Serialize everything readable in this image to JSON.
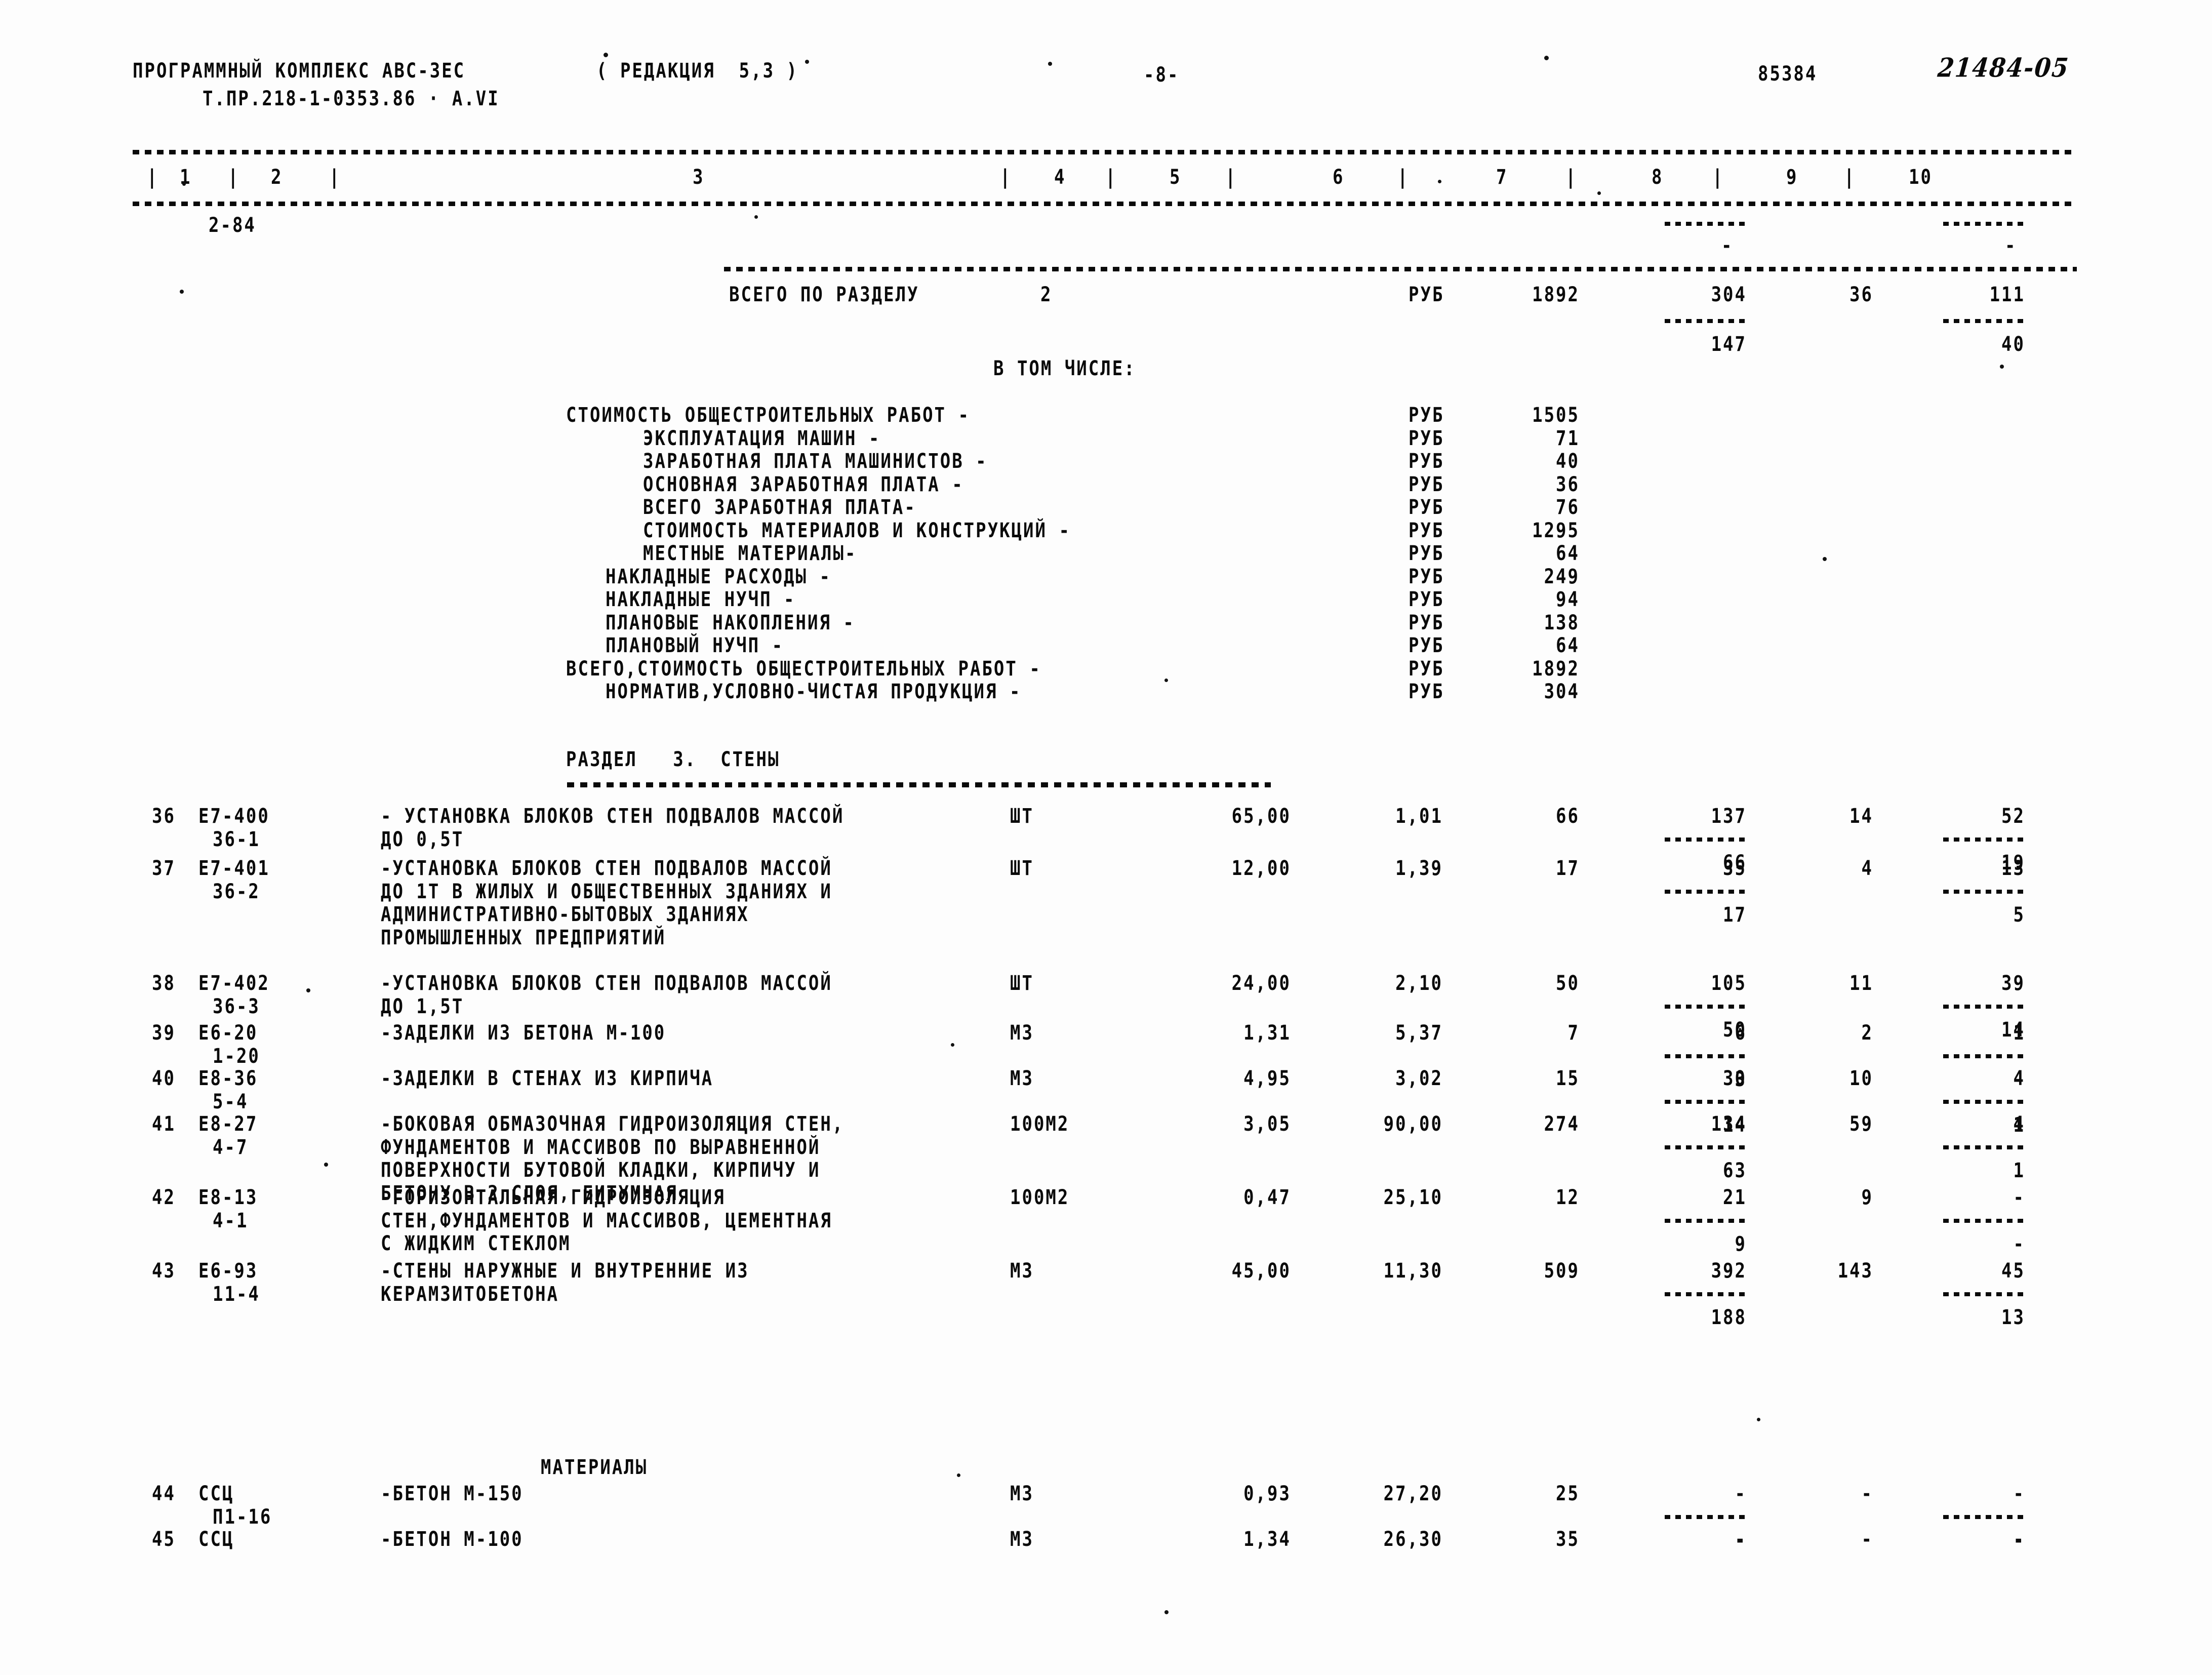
{
  "header": {
    "program_title": "ПРОГРАММНЫЙ КОМПЛЕКС АВС-3ЕС",
    "edition": "( РЕДАКЦИЯ  5,3 )",
    "project_code": "Т.ПР.218-1-0353.86 · А.VI",
    "page_marker": "-8-",
    "doc_number": "85384",
    "hand_number": "21484-05"
  },
  "columns": [
    "1",
    "2",
    "3",
    "4",
    "5",
    "6",
    "7",
    "8",
    "9",
    "10"
  ],
  "marker_row": {
    "code": "2-84"
  },
  "section_total": {
    "label": "ВСЕГО ПО РАЗДЕЛУ",
    "number": "2",
    "unit": "РУБ",
    "c7": "1892",
    "c8": "304",
    "c9": "36",
    "c10": "111",
    "sub_c8": "147",
    "sub_c10": "40"
  },
  "in_which": "В ТОМ ЧИСЛЕ:",
  "breakdown": [
    {
      "label": "СТОИМОСТЬ ОБЩЕСТРОИТЕЛЬНЫХ РАБОТ -",
      "indent": 0,
      "unit": "РУБ",
      "value": "1505"
    },
    {
      "label": "ЭКСПЛУАТАЦИЯ МАШИН -",
      "indent": 2,
      "unit": "РУБ",
      "value": "71"
    },
    {
      "label": "ЗАРАБОТНАЯ ПЛАТА МАШИНИСТОВ -",
      "indent": 2,
      "unit": "РУБ",
      "value": "40"
    },
    {
      "label": "ОСНОВНАЯ ЗАРАБОТНАЯ ПЛАТА -",
      "indent": 2,
      "unit": "РУБ",
      "value": "36"
    },
    {
      "label": "ВСЕГО ЗАРАБОТНАЯ ПЛАТА-",
      "indent": 2,
      "unit": "РУБ",
      "value": "76"
    },
    {
      "label": "СТОИМОСТЬ МАТЕРИАЛОВ И КОНСТРУКЦИЙ -",
      "indent": 2,
      "unit": "РУБ",
      "value": "1295"
    },
    {
      "label": "МЕСТНЫЕ МАТЕРИАЛЫ-",
      "indent": 2,
      "unit": "РУБ",
      "value": "64"
    },
    {
      "label": "НАКЛАДНЫЕ РАСХОДЫ -",
      "indent": 1,
      "unit": "РУБ",
      "value": "249"
    },
    {
      "label": "НАКЛАДНЫЕ НУЧП -",
      "indent": 1,
      "unit": "РУБ",
      "value": "94"
    },
    {
      "label": "ПЛАНОВЫЕ НАКОПЛЕНИЯ -",
      "indent": 1,
      "unit": "РУБ",
      "value": "138"
    },
    {
      "label": "ПЛАНОВЫЙ НУЧП -",
      "indent": 1,
      "unit": "РУБ",
      "value": "64"
    },
    {
      "label": "ВСЕГО,СТОИМОСТЬ ОБЩЕСТРОИТЕЛЬНЫХ РАБОТ -",
      "indent": 0,
      "unit": "РУБ",
      "value": "1892"
    },
    {
      "label": "НОРМАТИВ,УСЛОВНО-ЧИСТАЯ ПРОДУКЦИЯ -",
      "indent": 1,
      "unit": "РУБ",
      "value": "304"
    }
  ],
  "section_heading": "РАЗДЕЛ   3.  СТЕНЫ",
  "materials_heading": "МАТЕРИАЛЫ",
  "rows": [
    {
      "no": "36",
      "code": "Е7-400",
      "sub": "36-1",
      "desc": [
        "- УСТАНОВКА БЛОКОВ СТЕН ПОДВАЛОВ МАССОЙ",
        "ДО 0,5Т"
      ],
      "unit": "ШТ",
      "qty": "65,00",
      "price": "1,01",
      "c7": "66",
      "c8": "137",
      "c9": "14",
      "c10": "52",
      "sub_c8": "66",
      "sub_c10": "19"
    },
    {
      "no": "37",
      "code": "Е7-401",
      "sub": "36-2",
      "desc": [
        "-УСТАНОВКА БЛОКОВ СТЕН ПОДВАЛОВ МАССОЙ",
        "ДО 1Т В ЖИЛЫХ И ОБЩЕСТВЕННЫХ ЗДАНИЯХ И",
        "АДМИНИСТРАТИВНО-БЫТОВЫХ ЗДАНИЯХ",
        "ПРОМЫШЛЕННЫХ ПРЕДПРИЯТИЙ"
      ],
      "unit": "ШТ",
      "qty": "12,00",
      "price": "1,39",
      "c7": "17",
      "c8": "35",
      "c9": "4",
      "c10": "13",
      "sub_c8": "17",
      "sub_c10": "5"
    },
    {
      "no": "38",
      "code": "Е7-402",
      "sub": "36-3",
      "desc": [
        "-УСТАНОВКА БЛОКОВ СТЕН ПОДВАЛОВ МАССОЙ",
        "ДО 1,5Т"
      ],
      "unit": "ШТ",
      "qty": "24,00",
      "price": "2,10",
      "c7": "50",
      "c8": "105",
      "c9": "11",
      "c10": "39",
      "sub_c8": "50",
      "sub_c10": "14"
    },
    {
      "no": "39",
      "code": "Е6-20",
      "sub": "1-20",
      "desc": [
        "-ЗАДЕЛКИ ИЗ БЕТОНА М-100"
      ],
      "unit": "М3",
      "qty": "1,31",
      "price": "5,37",
      "c7": "7",
      "c8": "6",
      "c9": "2",
      "c10": "1",
      "sub_c8": "3",
      "sub_c10": "-"
    },
    {
      "no": "40",
      "code": "Е8-36",
      "sub": "5-4",
      "desc": [
        "-ЗАДЕЛКИ В СТЕНАХ ИЗ КИРПИЧА"
      ],
      "unit": "М3",
      "qty": "4,95",
      "price": "3,02",
      "c7": "15",
      "c8": "30",
      "c9": "10",
      "c10": "4",
      "sub_c8": "14",
      "sub_c10": "1"
    },
    {
      "no": "41",
      "code": "Е8-27",
      "sub": "4-7",
      "desc": [
        "-БОКОВАЯ ОБМАЗОЧНАЯ ГИДРОИЗОЛЯЦИЯ СТЕН,",
        "ФУНДАМЕНТОВ И МАССИВОВ ПО ВЫРАВНЕННОЙ",
        "ПОВЕРХНОСТИ БУТОВОЙ КЛАДКИ, КИРПИЧУ И",
        "БЕТОНУ В 2 СЛОЯ, БИТУМНАЯ"
      ],
      "unit": "100М2",
      "qty": "3,05",
      "price": "90,00",
      "c7": "274",
      "c8": "134",
      "c9": "59",
      "c10": "4",
      "sub_c8": "63",
      "sub_c10": "1"
    },
    {
      "no": "42",
      "code": "Е8-13",
      "sub": "4-1",
      "desc": [
        "-ГОРИЗОНТАЛЬНАЯ ГИДРОИЗОЛЯЦИЯ",
        "СТЕН,ФУНДАМЕНТОВ И МАССИВОВ, ЦЕМЕНТНАЯ",
        "С ЖИДКИМ СТЕКЛОМ"
      ],
      "unit": "100М2",
      "qty": "0,47",
      "price": "25,10",
      "c7": "12",
      "c8": "21",
      "c9": "9",
      "c10": "-",
      "sub_c8": "9",
      "sub_c10": "-"
    },
    {
      "no": "43",
      "code": "Е6-93",
      "sub": "11-4",
      "desc": [
        "-СТЕНЫ НАРУЖНЫЕ И ВНУТРЕННИЕ ИЗ",
        "КЕРАМЗИТОБЕТОНА"
      ],
      "unit": "М3",
      "qty": "45,00",
      "price": "11,30",
      "c7": "509",
      "c8": "392",
      "c9": "143",
      "c10": "45",
      "sub_c8": "188",
      "sub_c10": "13"
    },
    {
      "no": "44",
      "code": "ССЦ",
      "sub": "П1-16",
      "desc": [
        "-БЕТОН М-150"
      ],
      "unit": "М3",
      "qty": "0,93",
      "price": "27,20",
      "c7": "25",
      "c8": "-",
      "c9": "-",
      "c10": "-",
      "sub_c8": "-",
      "sub_c10": "-"
    },
    {
      "no": "45",
      "code": "ССЦ",
      "sub": "",
      "desc": [
        "-БЕТОН М-100"
      ],
      "unit": "М3",
      "qty": "1,34",
      "price": "26,30",
      "c7": "35",
      "c8": "-",
      "c9": "-",
      "c10": "-",
      "sub_c8": "",
      "sub_c10": ""
    }
  ]
}
